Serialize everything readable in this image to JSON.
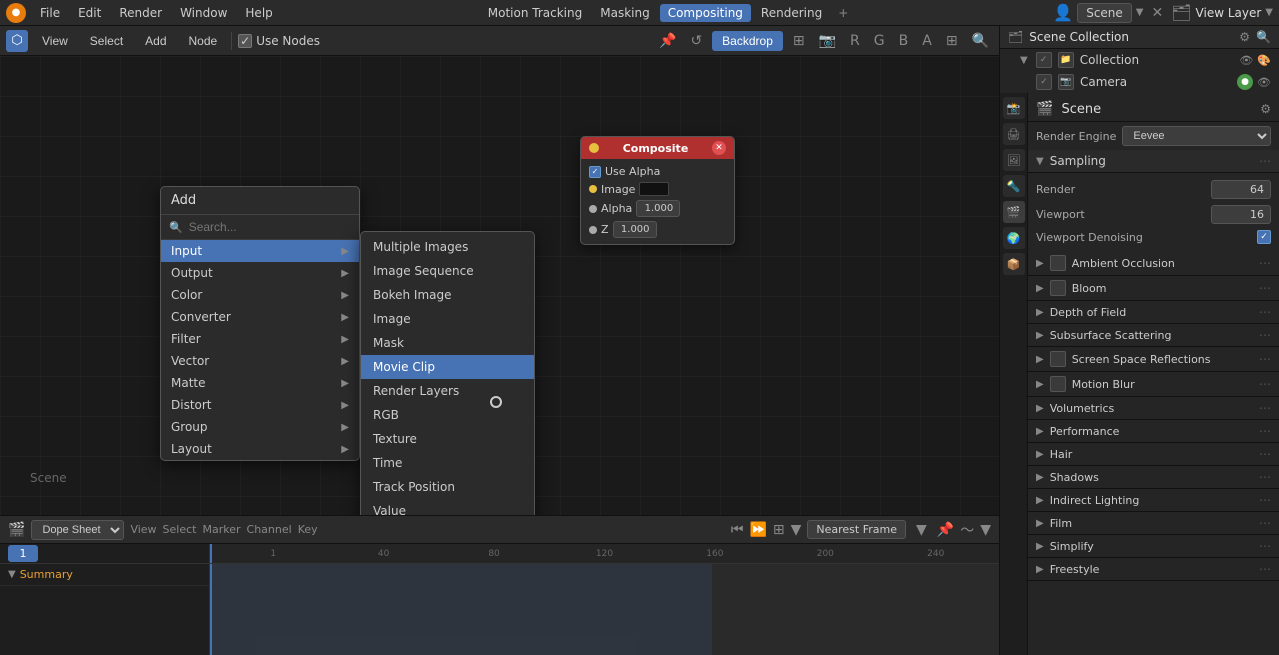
{
  "app": {
    "title": "Blender",
    "menus": [
      "File",
      "Edit",
      "Render",
      "Window",
      "Help"
    ],
    "workspace_tabs": [
      "Motion Tracking",
      "Masking",
      "Compositing",
      "Rendering"
    ],
    "active_tab": "Compositing"
  },
  "toolbar": {
    "view_label": "View",
    "select_label": "Select",
    "add_label": "Add",
    "node_label": "Node",
    "use_nodes_label": "Use Nodes",
    "backdrop_label": "Backdrop"
  },
  "scene": {
    "name": "Scene",
    "label": "Scene"
  },
  "view_layer": {
    "title": "View Layer"
  },
  "composite_node": {
    "title": "Composite",
    "use_alpha_label": "Use Alpha",
    "image_label": "Image",
    "alpha_label": "Alpha",
    "alpha_value": "1.000",
    "z_label": "Z",
    "z_value": "1.000"
  },
  "add_menu": {
    "title": "Add",
    "search_placeholder": "Search...",
    "items": [
      {
        "label": "Input",
        "has_arrow": true,
        "active": true
      },
      {
        "label": "Output",
        "has_arrow": true
      },
      {
        "label": "Color",
        "has_arrow": true
      },
      {
        "label": "Converter",
        "has_arrow": true
      },
      {
        "label": "Filter",
        "has_arrow": true
      },
      {
        "label": "Vector",
        "has_arrow": true
      },
      {
        "label": "Matte",
        "has_arrow": true
      },
      {
        "label": "Distort",
        "has_arrow": true
      },
      {
        "label": "Group",
        "has_arrow": true
      },
      {
        "label": "Layout",
        "has_arrow": true
      }
    ]
  },
  "submenu": {
    "items": [
      {
        "label": "Multiple Images",
        "active": false
      },
      {
        "label": "Image Sequence",
        "active": false
      },
      {
        "label": "Bokeh Image",
        "active": false
      },
      {
        "label": "Image",
        "active": false
      },
      {
        "label": "Mask",
        "active": false
      },
      {
        "label": "Movie Clip",
        "active": true
      },
      {
        "label": "Render Layers",
        "active": false
      },
      {
        "label": "RGB",
        "active": false
      },
      {
        "label": "Texture",
        "active": false
      },
      {
        "label": "Time",
        "active": false
      },
      {
        "label": "Track Position",
        "active": false
      },
      {
        "label": "Value",
        "active": false
      }
    ]
  },
  "outliner": {
    "title": "Scene Collection",
    "items": [
      {
        "label": "Collection",
        "level": 1,
        "icon": "collection"
      },
      {
        "label": "Camera",
        "level": 2,
        "icon": "camera"
      }
    ]
  },
  "properties": {
    "title": "Scene",
    "render_engine_label": "Render Engine",
    "render_engine_value": "Eevee",
    "sections": [
      {
        "label": "Sampling",
        "expanded": true,
        "props": [
          {
            "label": "Render",
            "value": "64"
          },
          {
            "label": "Viewport",
            "value": "16"
          },
          {
            "label": "Viewport Denoising",
            "type": "checkbox",
            "checked": true
          }
        ]
      },
      {
        "label": "Ambient Occlusion",
        "expanded": false,
        "has_checkbox": true
      },
      {
        "label": "Bloom",
        "expanded": false,
        "has_checkbox": true
      },
      {
        "label": "Depth of Field",
        "expanded": false
      },
      {
        "label": "Subsurface Scattering",
        "expanded": false
      },
      {
        "label": "Screen Space Reflections",
        "expanded": false,
        "has_checkbox": true
      },
      {
        "label": "Motion Blur",
        "expanded": false,
        "has_checkbox": true
      },
      {
        "label": "Volumetrics",
        "expanded": false
      },
      {
        "label": "Performance",
        "expanded": false
      },
      {
        "label": "Hair",
        "expanded": false
      },
      {
        "label": "Shadows",
        "expanded": false
      },
      {
        "label": "Indirect Lighting",
        "expanded": false
      },
      {
        "label": "Film",
        "expanded": false
      },
      {
        "label": "Simplify",
        "expanded": false
      },
      {
        "label": "Freestyle",
        "expanded": false
      }
    ]
  },
  "timeline": {
    "mode": "Dope Sheet",
    "submode": "Summary",
    "menu_items": [
      "View",
      "Select",
      "Marker",
      "Channel",
      "Key"
    ],
    "nearest_frame_label": "Nearest Frame",
    "frame_current": "1",
    "frame_markers": [
      "1",
      "40",
      "80",
      "120",
      "160",
      "200",
      "240"
    ],
    "ruler_numbers": [
      1,
      40,
      80,
      120,
      160,
      200,
      240
    ]
  }
}
